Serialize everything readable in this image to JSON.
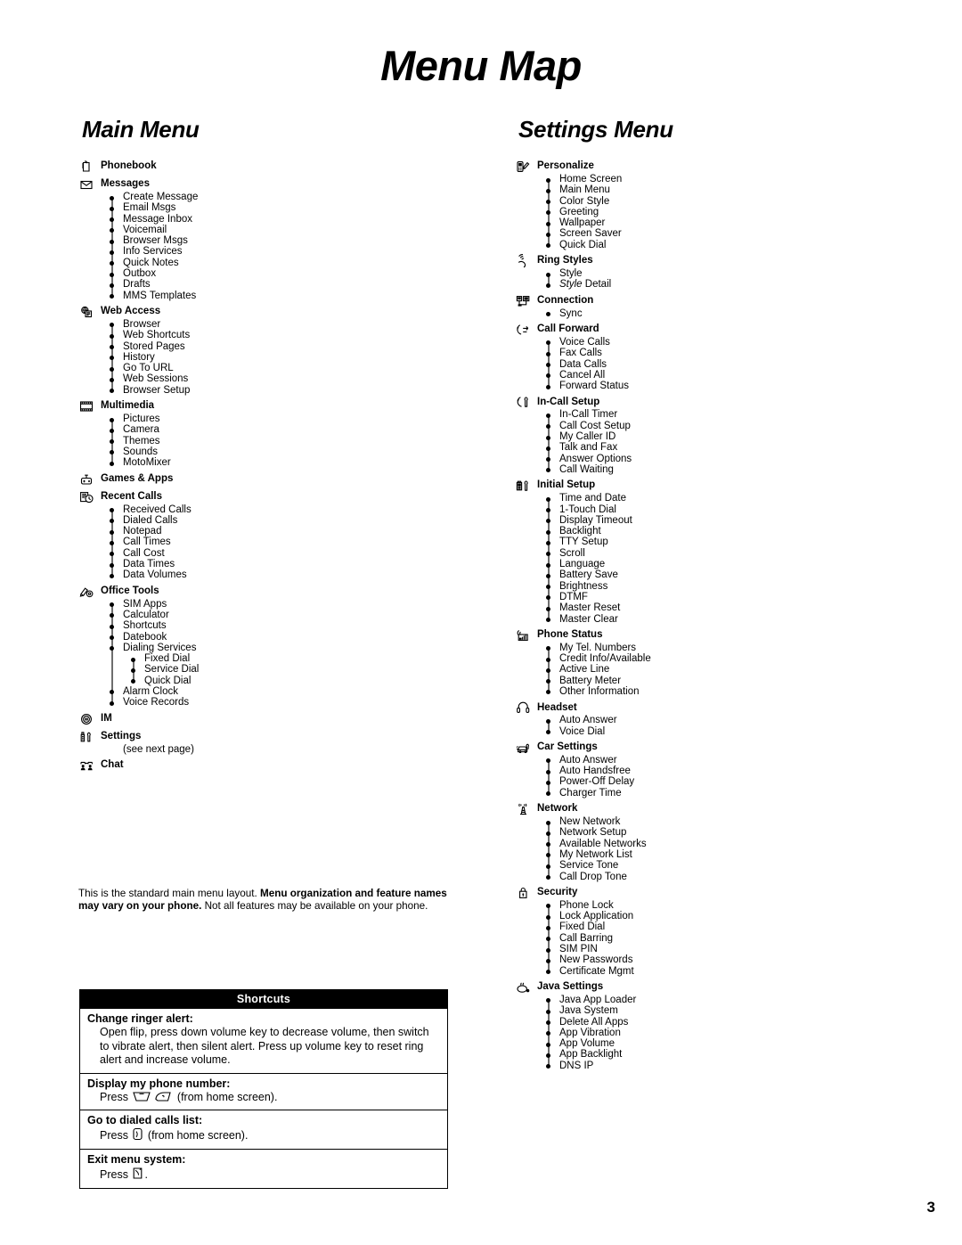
{
  "document": {
    "title": "Menu Map",
    "page_number": "3"
  },
  "main_menu": {
    "heading": "Main Menu",
    "entries": [
      {
        "icon": "phonebook-icon",
        "label": "Phonebook",
        "items": []
      },
      {
        "icon": "envelope-icon",
        "label": "Messages",
        "items": [
          "Create Message",
          "Email Msgs",
          "Message Inbox",
          "Voicemail",
          "Browser Msgs",
          "Info Services",
          "Quick Notes",
          "Outbox",
          "Drafts",
          "MMS Templates"
        ]
      },
      {
        "icon": "web-access-icon",
        "label": "Web Access",
        "items": [
          "Browser",
          "Web Shortcuts",
          "Stored Pages",
          "History",
          "Go To URL",
          "Web Sessions",
          "Browser Setup"
        ]
      },
      {
        "icon": "multimedia-icon",
        "label": "Multimedia",
        "items": [
          "Pictures",
          "Camera",
          "Themes",
          "Sounds",
          "MotoMixer"
        ]
      },
      {
        "icon": "games-apps-icon",
        "label": "Games & Apps",
        "items": []
      },
      {
        "icon": "recent-calls-icon",
        "label": "Recent Calls",
        "items": [
          "Received Calls",
          "Dialed Calls",
          "Notepad",
          "Call Times",
          "Call Cost",
          "Data Times",
          "Data Volumes"
        ]
      },
      {
        "icon": "office-tools-icon",
        "label": "Office Tools",
        "items": [
          "SIM Apps",
          "Calculator",
          "Shortcuts",
          "Datebook",
          "Dialing Services"
        ],
        "nested_after": 5,
        "nested": [
          "Fixed Dial",
          "Service Dial",
          "Quick Dial"
        ],
        "items_tail": [
          "Alarm Clock",
          "Voice Records"
        ]
      },
      {
        "icon": "im-icon",
        "label": "IM",
        "items": []
      },
      {
        "icon": "settings-icon",
        "label": "Settings",
        "items": [],
        "note": "(see next page)"
      },
      {
        "icon": "chat-icon",
        "label": "Chat",
        "items": []
      }
    ],
    "note": {
      "part1": "This is the standard main menu layout. ",
      "bold": "Menu organization and feature names may vary on your phone.",
      "part2": " Not all features may be available on your phone."
    }
  },
  "settings_menu": {
    "heading": "Settings Menu",
    "entries": [
      {
        "icon": "personalize-icon",
        "label": "Personalize",
        "items": [
          "Home Screen",
          "Main Menu",
          "Color Style",
          "Greeting",
          "Wallpaper",
          "Screen Saver",
          "Quick Dial"
        ]
      },
      {
        "icon": "ring-styles-icon",
        "label": "Ring Styles",
        "items": [
          "Style"
        ],
        "italic_items": [
          {
            "italic": "Style",
            "rest": " Detail"
          }
        ]
      },
      {
        "icon": "connection-icon",
        "label": "Connection",
        "items": [
          "Sync"
        ]
      },
      {
        "icon": "call-forward-icon",
        "label": "Call Forward",
        "items": [
          "Voice Calls",
          "Fax Calls",
          "Data Calls",
          "Cancel All",
          "Forward Status"
        ]
      },
      {
        "icon": "in-call-setup-icon",
        "label": "In-Call Setup",
        "items": [
          "In-Call Timer",
          "Call Cost Setup",
          "My Caller ID",
          "Talk and Fax",
          "Answer Options",
          "Call Waiting"
        ]
      },
      {
        "icon": "initial-setup-icon",
        "label": "Initial Setup",
        "items": [
          "Time and Date",
          "1-Touch Dial",
          "Display Timeout",
          "Backlight",
          "TTY Setup",
          "Scroll",
          "Language",
          "Battery Save",
          "Brightness",
          "DTMF",
          "Master Reset",
          "Master Clear"
        ]
      },
      {
        "icon": "phone-status-icon",
        "label": "Phone Status",
        "items": [
          "My Tel. Numbers",
          "Credit Info/Available",
          "Active Line",
          "Battery Meter",
          "Other Information"
        ]
      },
      {
        "icon": "headset-icon",
        "label": "Headset",
        "items": [
          "Auto Answer",
          "Voice Dial"
        ]
      },
      {
        "icon": "car-settings-icon",
        "label": "Car Settings",
        "items": [
          "Auto Answer",
          "Auto Handsfree",
          "Power-Off Delay",
          "Charger Time"
        ]
      },
      {
        "icon": "network-icon",
        "label": "Network",
        "items": [
          "New Network",
          "Network Setup",
          "Available Networks",
          "My Network List",
          "Service Tone",
          "Call Drop Tone"
        ]
      },
      {
        "icon": "security-icon",
        "label": "Security",
        "items": [
          "Phone Lock",
          "Lock Application",
          "Fixed Dial",
          "Call Barring",
          "SIM PIN",
          "New Passwords",
          "Certificate Mgmt"
        ]
      },
      {
        "icon": "java-settings-icon",
        "label": "Java Settings",
        "items": [
          "Java App Loader",
          "Java System",
          "Delete All Apps",
          "App Vibration",
          "App Volume",
          "App Backlight",
          "DNS IP"
        ]
      }
    ]
  },
  "shortcuts": {
    "header": "Shortcuts",
    "rows": [
      {
        "title": "Change ringer alert:",
        "body": "Open flip, press down volume key to decrease volume, then switch to vibrate alert, then silent alert. Press up volume key to reset ring alert and increase volume."
      },
      {
        "title": "Display my phone number:",
        "body_before": "Press ",
        "keys": [
          "menu-key-icon",
          "smart-key-icon"
        ],
        "body_after": " (from home screen)."
      },
      {
        "title": "Go to dialed calls list:",
        "body_before": "Press ",
        "keys": [
          "send-key-icon"
        ],
        "body_after": " (from home screen)."
      },
      {
        "title": "Exit menu system:",
        "body_before": "Press ",
        "keys": [
          "power-key-icon"
        ],
        "body_after": "."
      }
    ]
  }
}
